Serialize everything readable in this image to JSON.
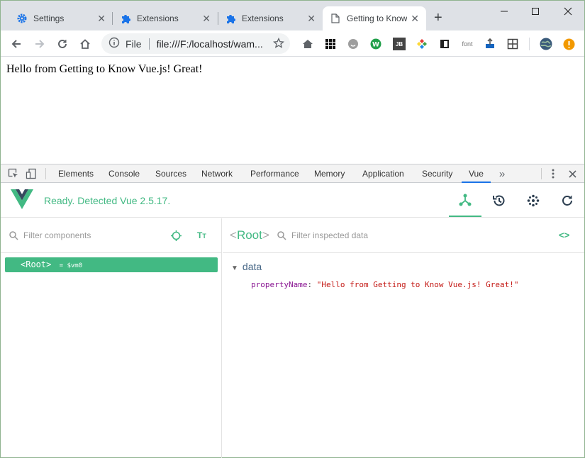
{
  "browser": {
    "tabs": [
      {
        "title": "Settings",
        "icon": "gear-icon"
      },
      {
        "title": "Extensions",
        "icon": "puzzle-icon"
      },
      {
        "title": "Extensions",
        "icon": "puzzle-icon"
      },
      {
        "title": "Getting to Know",
        "icon": "document-icon"
      }
    ],
    "omnibox": {
      "scheme_label": "File",
      "url": "file:///F:/localhost/wam..."
    },
    "extensions": {
      "font_label": "font",
      "jb_label": "JB"
    }
  },
  "page": {
    "text": "Hello from Getting to Know Vue.js! Great!"
  },
  "devtools": {
    "tabs": [
      "Elements",
      "Console",
      "Sources",
      "Network",
      "Performance",
      "Memory",
      "Application",
      "Security",
      "Vue"
    ],
    "active_tab": "Vue",
    "vue": {
      "status": "Ready. Detected Vue 2.5.17.",
      "filter_components_placeholder": "Filter components",
      "filter_data_placeholder": "Filter inspected data",
      "root_component": "Root",
      "root_vm": "= $vm0",
      "data_section": "data",
      "prop_key": "propertyName",
      "prop_value": "\"Hello from Getting to Know Vue.js! Great!\""
    }
  },
  "colors": {
    "vue_green": "#42b983",
    "chrome_tabstrip": "#dee1e6",
    "key_purple": "#881391",
    "string_red": "#c41a16"
  }
}
